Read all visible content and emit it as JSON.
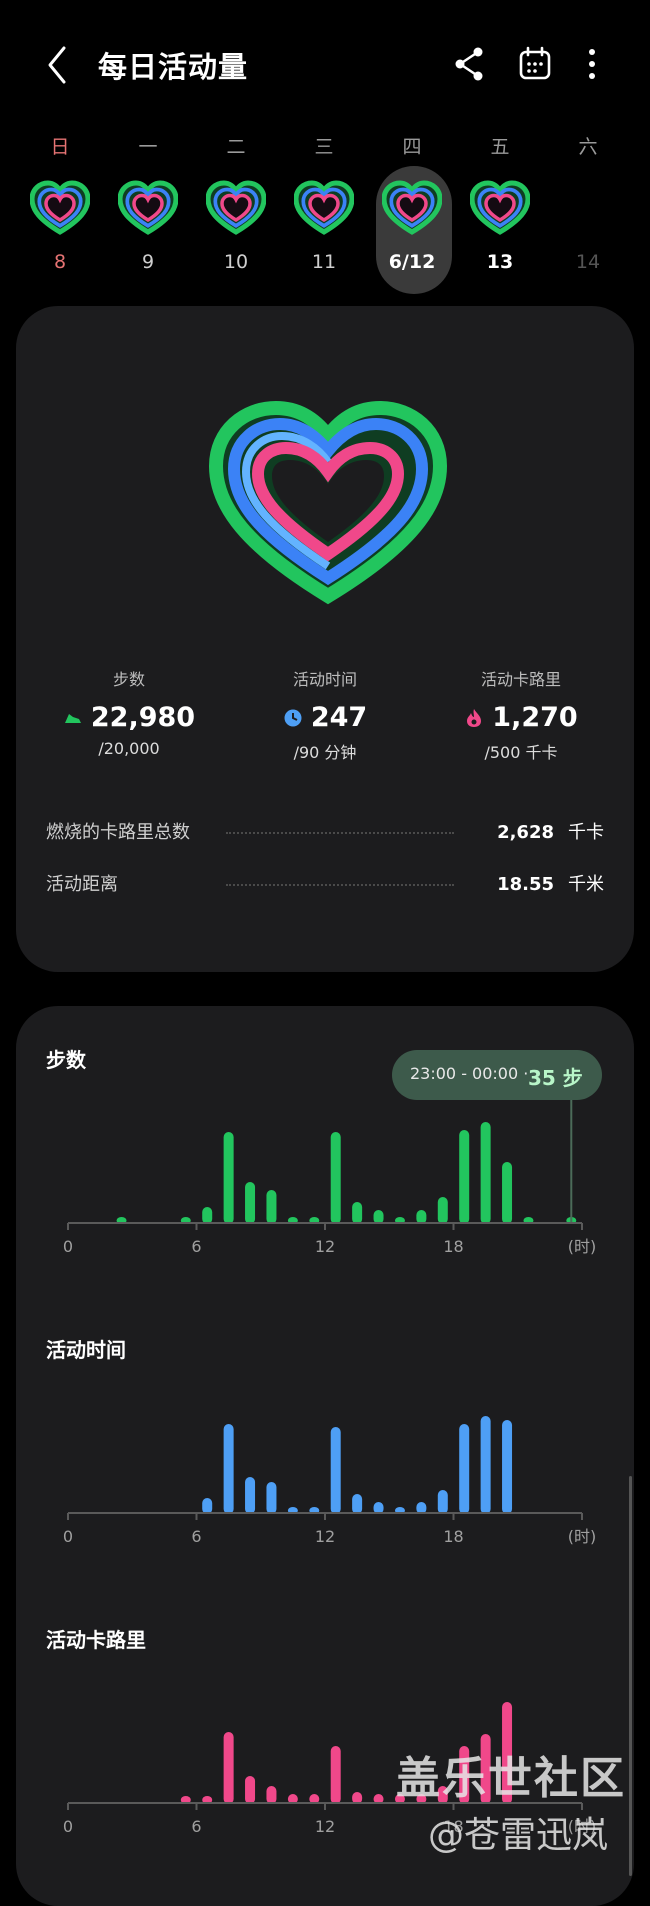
{
  "header": {
    "title": "每日活动量",
    "back_icon": "back-arrow-icon",
    "share_icon": "share-icon",
    "calendar_icon": "calendar-icon",
    "more_icon": "more-vertical-icon"
  },
  "week": [
    {
      "name": "日",
      "date": "8",
      "ring": true,
      "weekend": true
    },
    {
      "name": "一",
      "date": "9",
      "ring": true
    },
    {
      "name": "二",
      "date": "10",
      "ring": true
    },
    {
      "name": "三",
      "date": "11",
      "ring": true
    },
    {
      "name": "四",
      "date": "6/12",
      "ring": true,
      "selected": true
    },
    {
      "name": "五",
      "date": "13",
      "ring": true,
      "bold": true
    },
    {
      "name": "六",
      "date": "14",
      "ring": false,
      "future": true
    }
  ],
  "summary": {
    "steps": {
      "label": "步数",
      "value": "22,980",
      "goal": "/20,000",
      "icon": "shoe-icon",
      "color": "#22c55e"
    },
    "active_time": {
      "label": "活动时间",
      "value": "247",
      "goal": "/90 分钟",
      "icon": "clock-icon",
      "color": "#4e9ff5"
    },
    "active_calories": {
      "label": "活动卡路里",
      "value": "1,270",
      "goal": "/500 千卡",
      "icon": "flame-icon",
      "color": "#f0488a"
    },
    "total_calories": {
      "label": "燃烧的卡路里总数",
      "value": "2,628",
      "unit": "千卡"
    },
    "distance": {
      "label": "活动距离",
      "value": "18.55",
      "unit": "千米"
    }
  },
  "tooltip": {
    "time": "23:00 - 00:00 ·",
    "value": "35 步"
  },
  "sections": {
    "steps_title": "步数",
    "time_title": "活动时间",
    "cal_title": "活动卡路里"
  },
  "chart_data": [
    {
      "type": "bar",
      "title": "步数",
      "color": "#22c55e",
      "x": [
        0,
        1,
        2,
        3,
        4,
        5,
        6,
        7,
        8,
        9,
        10,
        11,
        12,
        13,
        14,
        15,
        16,
        17,
        18,
        19,
        20,
        21,
        22,
        23
      ],
      "xticks": [
        "0",
        "6",
        "12",
        "18"
      ],
      "xunit": "(时)",
      "values": [
        0,
        0,
        5,
        0,
        0,
        5,
        15,
        90,
        40,
        32,
        5,
        5,
        90,
        20,
        12,
        5,
        12,
        25,
        92,
        100,
        60,
        5,
        0,
        5
      ],
      "ylim": [
        0,
        100
      ]
    },
    {
      "type": "bar",
      "title": "活动时间",
      "color": "#4e9ff5",
      "x": [
        0,
        1,
        2,
        3,
        4,
        5,
        6,
        7,
        8,
        9,
        10,
        11,
        12,
        13,
        14,
        15,
        16,
        17,
        18,
        19,
        20,
        21,
        22,
        23
      ],
      "xticks": [
        "0",
        "6",
        "12",
        "18"
      ],
      "xunit": "(时)",
      "values": [
        0,
        0,
        0,
        0,
        0,
        0,
        14,
        88,
        35,
        30,
        5,
        5,
        85,
        18,
        10,
        5,
        10,
        22,
        88,
        96,
        92,
        0,
        0,
        0
      ],
      "ylim": [
        0,
        100
      ]
    },
    {
      "type": "bar",
      "title": "活动卡路里",
      "color": "#f0488a",
      "x": [
        0,
        1,
        2,
        3,
        4,
        5,
        6,
        7,
        8,
        9,
        10,
        11,
        12,
        13,
        14,
        15,
        16,
        17,
        18,
        19,
        20,
        21,
        22,
        23
      ],
      "xticks": [
        "0",
        "6",
        "12",
        "18"
      ],
      "xunit": "(时)",
      "values": [
        0,
        0,
        0,
        0,
        0,
        6,
        6,
        70,
        26,
        16,
        8,
        8,
        56,
        10,
        8,
        8,
        8,
        16,
        56,
        68,
        100,
        0,
        0,
        0
      ],
      "ylim": [
        0,
        100
      ]
    }
  ],
  "watermark": {
    "line1": "盖乐世社区",
    "line2": "@苍雷迅岚"
  }
}
